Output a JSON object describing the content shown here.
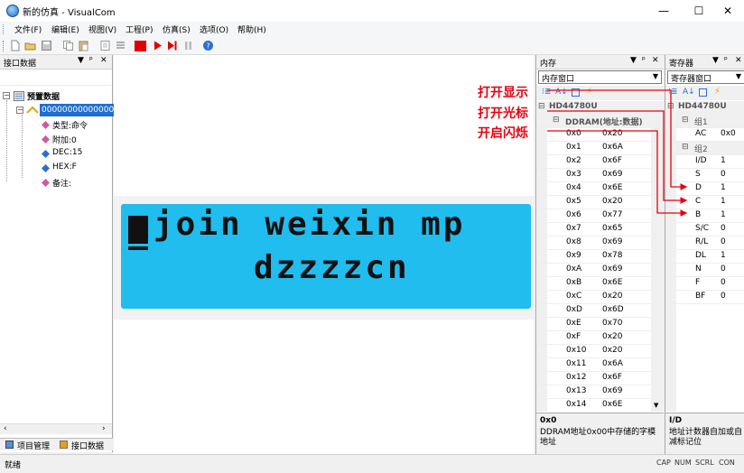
{
  "window": {
    "title": "新的仿真 - VisualCom",
    "minimize": "—",
    "maximize": "☐",
    "close": "✕"
  },
  "menu": [
    {
      "label": "文件(F)"
    },
    {
      "label": "编辑(E)"
    },
    {
      "label": "视图(V)"
    },
    {
      "label": "工程(P)"
    },
    {
      "label": "仿真(S)"
    },
    {
      "label": "选项(O)"
    },
    {
      "label": "帮助(H)"
    }
  ],
  "toolbar": {
    "icons": [
      "new-file-icon",
      "open-folder-icon",
      "save-icon",
      "copy-icon",
      "paste-icon",
      "page-icon",
      "list-icon",
      "stop-icon",
      "run-icon",
      "step-icon",
      "pause-icon",
      "help-icon"
    ],
    "colors": {
      "stop": "#e00000",
      "run": "#e00000",
      "help": "#2a6fd6"
    }
  },
  "left_panel": {
    "title": "接口数据",
    "tree": {
      "root": "预置数据",
      "selected": "00000000000000",
      "children": [
        "类型:命令",
        "附加:0",
        "DEC:15",
        "HEX:F",
        "备注:"
      ]
    },
    "tabs": [
      "项目管理",
      "接口数据"
    ]
  },
  "lcd": {
    "line1": "join weixin mp",
    "line2": "dzzzzcn",
    "background": "#20bdee"
  },
  "memory_panel": {
    "title": "内存",
    "combo": "内存窗口",
    "device": "HD44780U",
    "section": "DDRAM(地址:数据)",
    "rows": [
      {
        "addr": "0x0",
        "val": "0x20"
      },
      {
        "addr": "0x1",
        "val": "0x6A"
      },
      {
        "addr": "0x2",
        "val": "0x6F"
      },
      {
        "addr": "0x3",
        "val": "0x69"
      },
      {
        "addr": "0x4",
        "val": "0x6E"
      },
      {
        "addr": "0x5",
        "val": "0x20"
      },
      {
        "addr": "0x6",
        "val": "0x77"
      },
      {
        "addr": "0x7",
        "val": "0x65"
      },
      {
        "addr": "0x8",
        "val": "0x69"
      },
      {
        "addr": "0x9",
        "val": "0x78"
      },
      {
        "addr": "0xA",
        "val": "0x69"
      },
      {
        "addr": "0xB",
        "val": "0x6E"
      },
      {
        "addr": "0xC",
        "val": "0x20"
      },
      {
        "addr": "0xD",
        "val": "0x6D"
      },
      {
        "addr": "0xE",
        "val": "0x70"
      },
      {
        "addr": "0xF",
        "val": "0x20"
      },
      {
        "addr": "0x10",
        "val": "0x20"
      },
      {
        "addr": "0x11",
        "val": "0x6A"
      },
      {
        "addr": "0x12",
        "val": "0x6F"
      },
      {
        "addr": "0x13",
        "val": "0x69"
      },
      {
        "addr": "0x14",
        "val": "0x6E"
      }
    ],
    "desc_title": "0x0",
    "desc_text": "DDRAM地址0x00中存储的字模地址"
  },
  "register_panel": {
    "title": "寄存器",
    "combo": "寄存器窗口",
    "device": "HD44780U",
    "group1": "组1",
    "group1_rows": [
      {
        "name": "AC",
        "val": "0x0"
      }
    ],
    "group2": "组2",
    "group2_rows": [
      {
        "name": "I/D",
        "val": "1"
      },
      {
        "name": "S",
        "val": "0"
      },
      {
        "name": "D",
        "val": "1"
      },
      {
        "name": "C",
        "val": "1"
      },
      {
        "name": "B",
        "val": "1"
      },
      {
        "name": "S/C",
        "val": "0"
      },
      {
        "name": "R/L",
        "val": "0"
      },
      {
        "name": "DL",
        "val": "1"
      },
      {
        "name": "N",
        "val": "0"
      },
      {
        "name": "F",
        "val": "0"
      },
      {
        "name": "BF",
        "val": "0"
      }
    ],
    "desc_title": "I/D",
    "desc_text": "地址计数器自加或自减标记位"
  },
  "annotations": [
    "打开显示",
    "打开光标",
    "开启闪烁"
  ],
  "annotation_color": "#e8000f",
  "status": {
    "text": "就绪",
    "indicators": [
      "CAP",
      "NUM",
      "SCRL",
      "CON"
    ]
  }
}
